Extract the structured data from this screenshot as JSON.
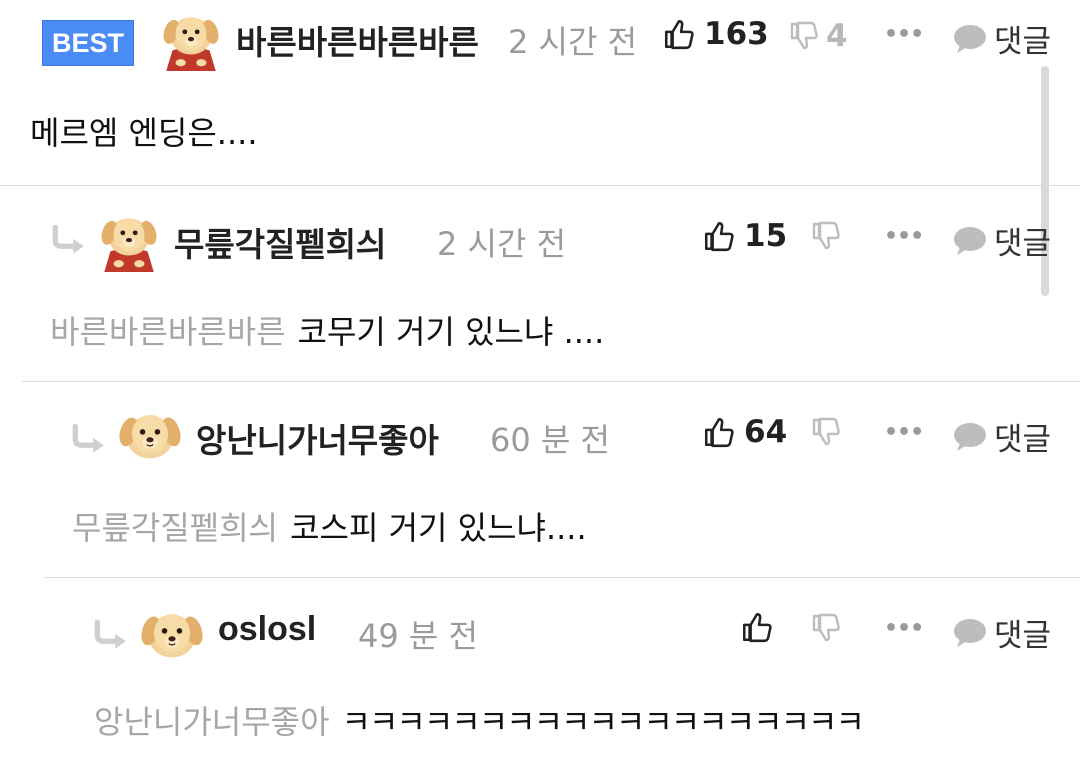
{
  "comments": [
    {
      "badge": "BEST",
      "nickname": "바른바른바른바른",
      "time": "2 시간 전",
      "likes": "163",
      "dislikes": "4",
      "more": "•••",
      "reply_label": "댓글",
      "mention": "",
      "text": "메르엠 엔딩은...."
    },
    {
      "nickname": "무릎각질펱희싀",
      "time": "2 시간 전",
      "likes": "15",
      "dislikes": "",
      "more": "•••",
      "reply_label": "댓글",
      "mention": "바른바른바른바른",
      "text": "코무기 거기 있느냐 ...."
    },
    {
      "nickname": "앙난니가너무좋아",
      "time": "60 분 전",
      "likes": "64",
      "dislikes": "",
      "more": "•••",
      "reply_label": "댓글",
      "mention": "무릎각질펱희싀",
      "text": "코스피 거기 있느냐...."
    },
    {
      "nickname": "oslosl",
      "time": "49 분 전",
      "likes": "",
      "dislikes": "",
      "more": "•••",
      "reply_label": "댓글",
      "mention": "앙난니가너무좋아",
      "text": "ㅋㅋㅋㅋㅋㅋㅋㅋㅋㅋㅋㅋㅋㅋㅋㅋㅋㅋㅋ"
    }
  ],
  "icons": {
    "like": "thumbs-up-icon",
    "dislike": "thumbs-down-icon",
    "reply": "speech-bubble-icon",
    "reply_arrow": "reply-arrow-icon",
    "avatar": "puppy-avatar-icon"
  },
  "colors": {
    "badge_bg": "#4a8bf5",
    "muted": "#9b9b9b",
    "mention": "#a6a6a6"
  }
}
